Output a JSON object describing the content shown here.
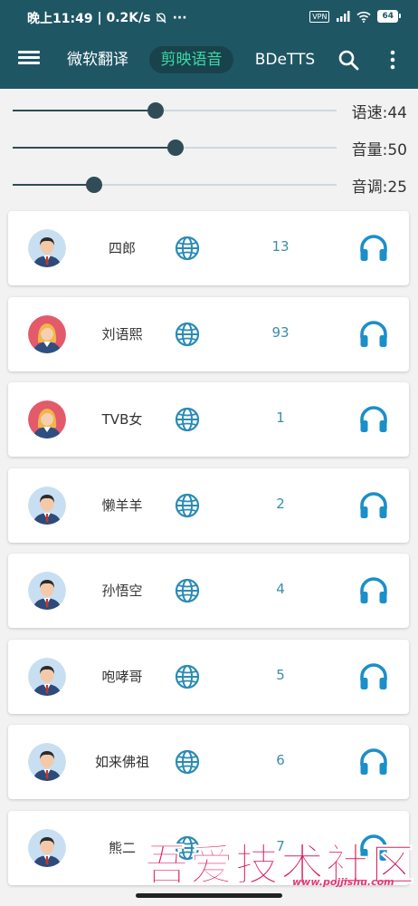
{
  "status": {
    "time": "晚上11:49",
    "speed": "0.2K/s",
    "dots": "···",
    "vpn": "VPN",
    "battery": "64"
  },
  "appbar": {
    "tabs": [
      {
        "label": "微软翻译",
        "selected": false
      },
      {
        "label": "剪映语音",
        "selected": true
      },
      {
        "label": "BDeTTS",
        "selected": false
      }
    ],
    "accent_color": "#3fd7a5",
    "bar_color": "#1f5664"
  },
  "sliders": [
    {
      "label": "语速:44",
      "value": 44
    },
    {
      "label": "音量:50",
      "value": 50
    },
    {
      "label": "音调:25",
      "value": 25
    }
  ],
  "voices": [
    {
      "name": "四郎",
      "number": "13",
      "avatar": "male-avatar"
    },
    {
      "name": "刘语熙",
      "number": "93",
      "avatar": "female-avatar"
    },
    {
      "name": "TVB女",
      "number": "1",
      "avatar": "female-avatar"
    },
    {
      "name": "懒羊羊",
      "number": "2",
      "avatar": "male-avatar"
    },
    {
      "name": "孙悟空",
      "number": "4",
      "avatar": "male-avatar"
    },
    {
      "name": "咆哮哥",
      "number": "5",
      "avatar": "male-avatar"
    },
    {
      "name": "如来佛祖",
      "number": "6",
      "avatar": "male-avatar"
    },
    {
      "name": "熊二",
      "number": "7",
      "avatar": "male-avatar"
    }
  ],
  "watermark": {
    "title": "吾爱技术社区",
    "url": "www.pojjishu.com"
  }
}
